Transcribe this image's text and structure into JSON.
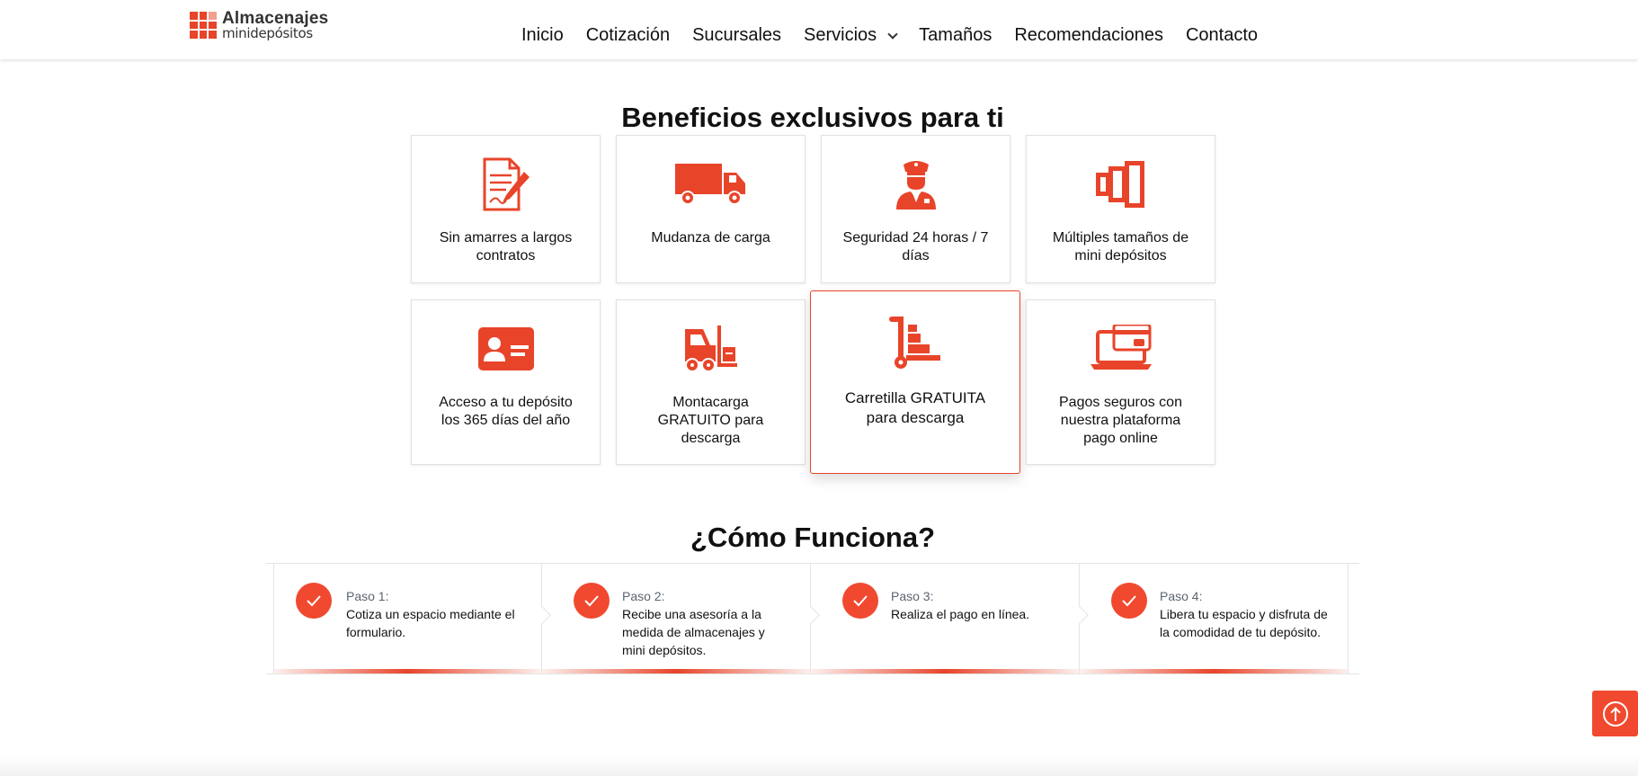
{
  "brand": {
    "name": "Almacenajes",
    "sub": "minidepósitos",
    "accent": "#e8442a"
  },
  "nav": {
    "items": [
      {
        "label": "Inicio"
      },
      {
        "label": "Cotización"
      },
      {
        "label": "Sucursales"
      },
      {
        "label": "Servicios"
      },
      {
        "label": "Tamaños"
      },
      {
        "label": "Recomendaciones"
      },
      {
        "label": "Contacto"
      }
    ]
  },
  "benefits": {
    "title": "Beneficios exclusivos para ti",
    "items": [
      {
        "label": "Sin amarres a largos contratos",
        "icon": "contract-icon"
      },
      {
        "label": "Mudanza de carga",
        "icon": "truck-icon"
      },
      {
        "label": "Seguridad 24 horas / 7 días",
        "icon": "security-guard-icon"
      },
      {
        "label": "Múltiples tamaños de mini depósitos",
        "icon": "storage-sizes-icon"
      },
      {
        "label": "Acceso a tu depósito los 365 días del año",
        "icon": "id-card-icon"
      },
      {
        "label": "Montacarga GRATUITO para descarga",
        "icon": "forklift-icon"
      },
      {
        "label": "Carretilla GRATUITA para descarga",
        "icon": "hand-truck-icon"
      },
      {
        "label": "Pagos seguros con nuestra plataforma pago online",
        "icon": "online-payment-icon"
      }
    ]
  },
  "how": {
    "title": "¿Cómo Funciona?",
    "steps": [
      {
        "label": "Paso 1:",
        "desc": "Cotiza un espacio mediante el formulario."
      },
      {
        "label": "Paso 2:",
        "desc": "Recibe una asesoría a la medida de almacenajes y mini depósitos."
      },
      {
        "label": "Paso 3:",
        "desc": "Realiza el pago en línea."
      },
      {
        "label": "Paso 4:",
        "desc": "Libera tu espacio y disfruta de la comodidad de tu depósito."
      }
    ]
  },
  "scroll_top": {
    "icon": "arrow-up-circle-icon"
  }
}
